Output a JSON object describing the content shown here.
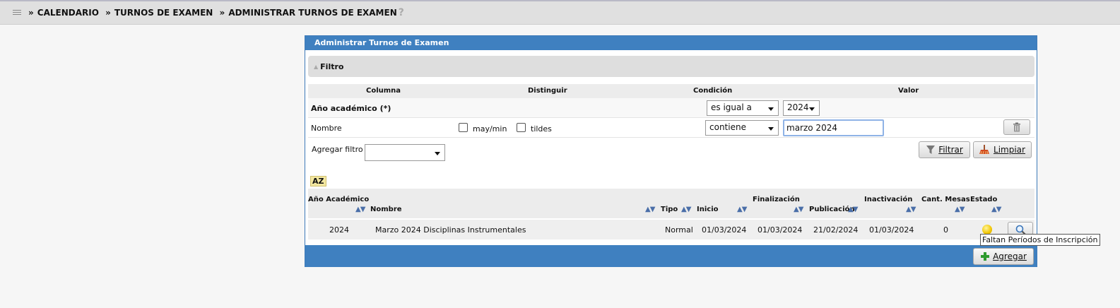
{
  "breadcrumb": {
    "items": [
      "CALENDARIO",
      "TURNOS DE EXAMEN",
      "ADMINISTRAR TURNOS DE EXAMEN"
    ],
    "separator": "»",
    "help": "?"
  },
  "panel": {
    "title": "Administrar Turnos de Examen",
    "filter_title": "Filtro"
  },
  "filter": {
    "headers": {
      "columna": "Columna",
      "distinguir": "Distinguir",
      "condicion": "Condición",
      "valor": "Valor"
    },
    "rows": [
      {
        "label": "Año académico (*)",
        "condition": "es igual a",
        "value": "2024"
      },
      {
        "label": "Nombre",
        "case_label": "may/min",
        "accents_label": "tildes",
        "condition": "contiene",
        "value": "marzo 2024"
      }
    ],
    "add_filter_label": "Agregar filtro",
    "add_filter_value": "",
    "filter_button": "Filtrar",
    "clear_button": "Limpiar"
  },
  "sort_icon_label": "AZ",
  "table": {
    "headers": {
      "anio": "Año Académico",
      "nombre": "Nombre",
      "tipo": "Tipo",
      "finalizacion": "Finalización",
      "inicio": "Inicio",
      "publicacion": "Publicación",
      "inactivacion": "Inactivación",
      "cant_mesas": "Cant. Mesas",
      "estado": "Estado"
    },
    "sort_arrows": "▲▼",
    "rows": [
      {
        "anio": "2024",
        "nombre": "Marzo 2024 Disciplinas Instrumentales",
        "tipo": "Normal",
        "inicio": "01/03/2024",
        "finalizacion": "01/03/2024",
        "publicacion": "21/02/2024",
        "inactivacion": "01/03/2024",
        "cant_mesas": "0",
        "estado_color": "#f0c400"
      }
    ]
  },
  "footer": {
    "add_button": "Agregar"
  },
  "tooltip": "Faltan Períodos de Inscripción",
  "colors": {
    "header_blue": "#3f80c0",
    "status_yellow": "#f0c400"
  }
}
